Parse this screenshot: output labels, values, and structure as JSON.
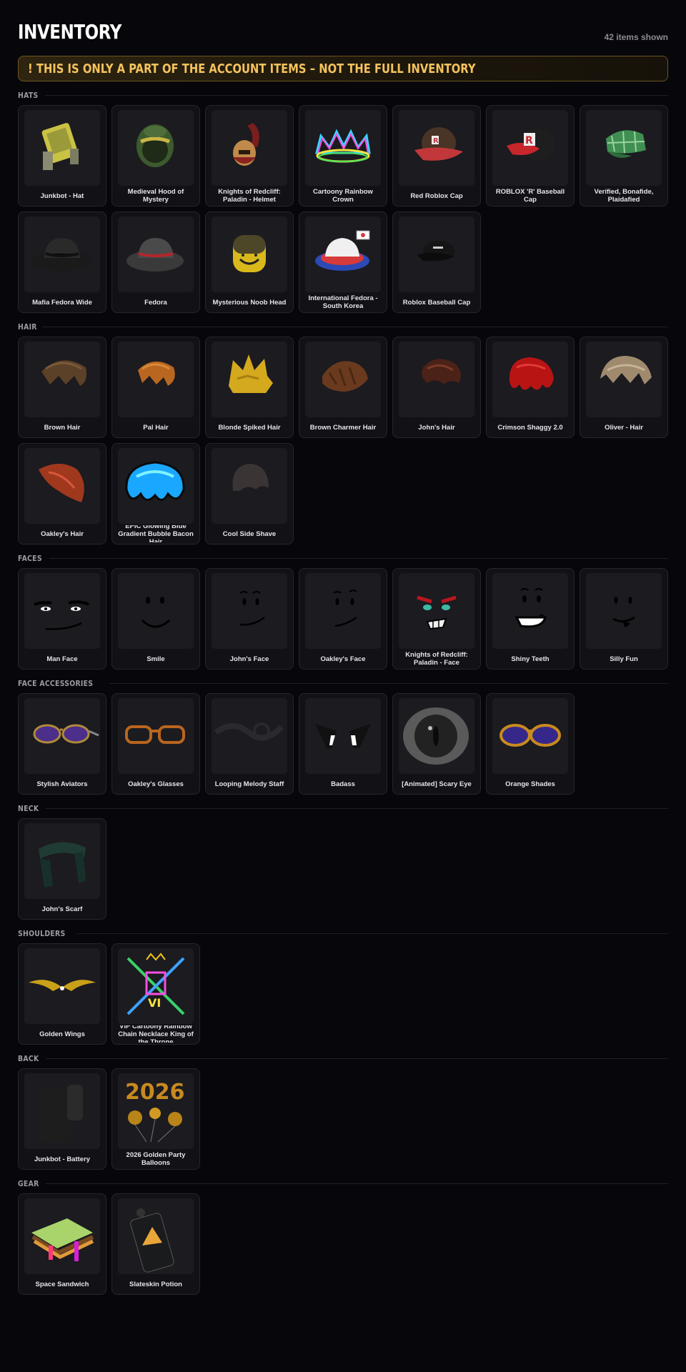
{
  "header": {
    "title": "INVENTORY",
    "count": "42 items shown"
  },
  "notice": {
    "icon": "exclamation-icon",
    "text": "! THIS IS ONLY A PART OF THE ACCOUNT ITEMS – NOT THE FULL INVENTORY"
  },
  "sections": [
    {
      "title": "HATS",
      "items": [
        {
          "label": "Junkbot - Hat",
          "icon": "junkbot-hat"
        },
        {
          "label": "Medieval Hood of Mystery",
          "icon": "hood"
        },
        {
          "label": "Knights of Redcliff: Paladin - Helmet",
          "icon": "helmet"
        },
        {
          "label": "Cartoony Rainbow Crown",
          "icon": "crown"
        },
        {
          "label": "Red Roblox Cap",
          "icon": "cap-red"
        },
        {
          "label": "ROBLOX 'R' Baseball Cap",
          "icon": "cap-r"
        },
        {
          "label": "Verified, Bonafide, Plaidafied",
          "icon": "plaid-cap"
        },
        {
          "label": "Mafia Fedora Wide",
          "icon": "fedora-black"
        },
        {
          "label": "Fedora",
          "icon": "fedora-gray"
        },
        {
          "label": "Mysterious Noob Head",
          "icon": "noob-head"
        },
        {
          "label": "International Fedora - South Korea",
          "icon": "fedora-korea"
        },
        {
          "label": "Roblox Baseball Cap",
          "icon": "cap-black"
        }
      ]
    },
    {
      "title": "HAIR",
      "items": [
        {
          "label": "Brown Hair",
          "icon": "hair-brown"
        },
        {
          "label": "Pal Hair",
          "icon": "hair-orange"
        },
        {
          "label": "Blonde Spiked Hair",
          "icon": "hair-blonde"
        },
        {
          "label": "Brown Charmer Hair",
          "icon": "hair-charmer"
        },
        {
          "label": "John's Hair",
          "icon": "hair-john"
        },
        {
          "label": "Crimson Shaggy 2.0",
          "icon": "hair-crimson"
        },
        {
          "label": "Oliver - Hair",
          "icon": "hair-oliver"
        },
        {
          "label": "Oakley's Hair",
          "icon": "hair-oakley"
        },
        {
          "label": "EPIC Glowing Blue Gradient Bubble Bacon Hair",
          "icon": "hair-blue"
        },
        {
          "label": "Cool Side Shave",
          "icon": "hair-shave"
        }
      ]
    },
    {
      "title": "FACES",
      "items": [
        {
          "label": "Man Face",
          "icon": "face-man"
        },
        {
          "label": "Smile",
          "icon": "face-smile"
        },
        {
          "label": "John's Face",
          "icon": "face-john"
        },
        {
          "label": "Oakley's Face",
          "icon": "face-oakley"
        },
        {
          "label": "Knights of Redcliff: Paladin - Face",
          "icon": "face-paladin"
        },
        {
          "label": "Shiny Teeth",
          "icon": "face-teeth"
        },
        {
          "label": "Silly Fun",
          "icon": "face-silly"
        }
      ]
    },
    {
      "title": "FACE ACCESSORIES",
      "items": [
        {
          "label": "Stylish Aviators",
          "icon": "aviators"
        },
        {
          "label": "Oakley's Glasses",
          "icon": "glasses"
        },
        {
          "label": "Looping Melody Staff",
          "icon": "melody"
        },
        {
          "label": "Badass",
          "icon": "badass"
        },
        {
          "label": "[Animated] Scary Eye",
          "icon": "eye"
        },
        {
          "label": "Orange Shades",
          "icon": "shades"
        }
      ]
    },
    {
      "title": "NECK",
      "items": [
        {
          "label": "John's Scarf",
          "icon": "scarf"
        }
      ]
    },
    {
      "title": "SHOULDERS",
      "items": [
        {
          "label": "Golden Wings",
          "icon": "wings"
        },
        {
          "label": "VIP Cartoony Rainbow Chain Necklace King of the Throne",
          "icon": "necklace"
        }
      ]
    },
    {
      "title": "BACK",
      "items": [
        {
          "label": "Junkbot - Battery",
          "icon": "battery"
        },
        {
          "label": "2026 Golden Party Balloons",
          "icon": "balloons"
        }
      ]
    },
    {
      "title": "GEAR",
      "items": [
        {
          "label": "Space Sandwich",
          "icon": "sandwich"
        },
        {
          "label": "Slateskin Potion",
          "icon": "potion"
        }
      ]
    }
  ]
}
